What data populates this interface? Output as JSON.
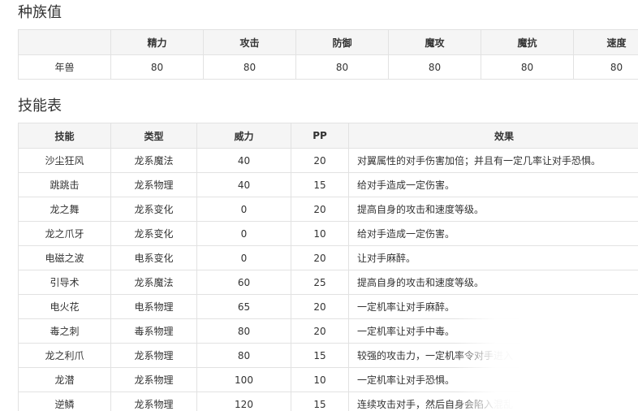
{
  "stats_section": {
    "title": "种族值",
    "headers": [
      "",
      "精力",
      "攻击",
      "防御",
      "魔攻",
      "魔抗",
      "速度"
    ],
    "rows": [
      [
        "年兽",
        "80",
        "80",
        "80",
        "80",
        "80",
        "80"
      ]
    ]
  },
  "skills_section": {
    "title": "技能表",
    "headers": [
      "技能",
      "类型",
      "威力",
      "PP",
      "效果"
    ],
    "rows": [
      [
        "沙尘狂风",
        "龙系魔法",
        "40",
        "20",
        "对翼属性的对手伤害加倍；并且有一定几率让对手恐惧。"
      ],
      [
        "跳跳击",
        "龙系物理",
        "40",
        "15",
        "给对手造成一定伤害。"
      ],
      [
        "龙之舞",
        "龙系变化",
        "0",
        "20",
        "提高自身的攻击和速度等级。"
      ],
      [
        "龙之爪牙",
        "龙系变化",
        "0",
        "10",
        "给对手造成一定伤害。"
      ],
      [
        "电磁之波",
        "电系变化",
        "0",
        "20",
        "让对手麻醉。"
      ],
      [
        "引导术",
        "龙系魔法",
        "60",
        "25",
        "提高自身的攻击和速度等级。"
      ],
      [
        "电火花",
        "电系物理",
        "65",
        "20",
        "一定机率让对手麻醉。"
      ],
      [
        "毒之刺",
        "毒系物理",
        "80",
        "20",
        "一定机率让对手中毒。"
      ],
      [
        "龙之利爪",
        "龙系物理",
        "80",
        "15",
        "较强的攻击力，一定机率令对手进入"
      ],
      [
        "龙潜",
        "龙系物理",
        "100",
        "10",
        "一定机率让对手恐惧。"
      ],
      [
        "逆鳞",
        "龙系物理",
        "120",
        "15",
        "连续攻击对手，然后自身会陷入混乱"
      ]
    ]
  }
}
